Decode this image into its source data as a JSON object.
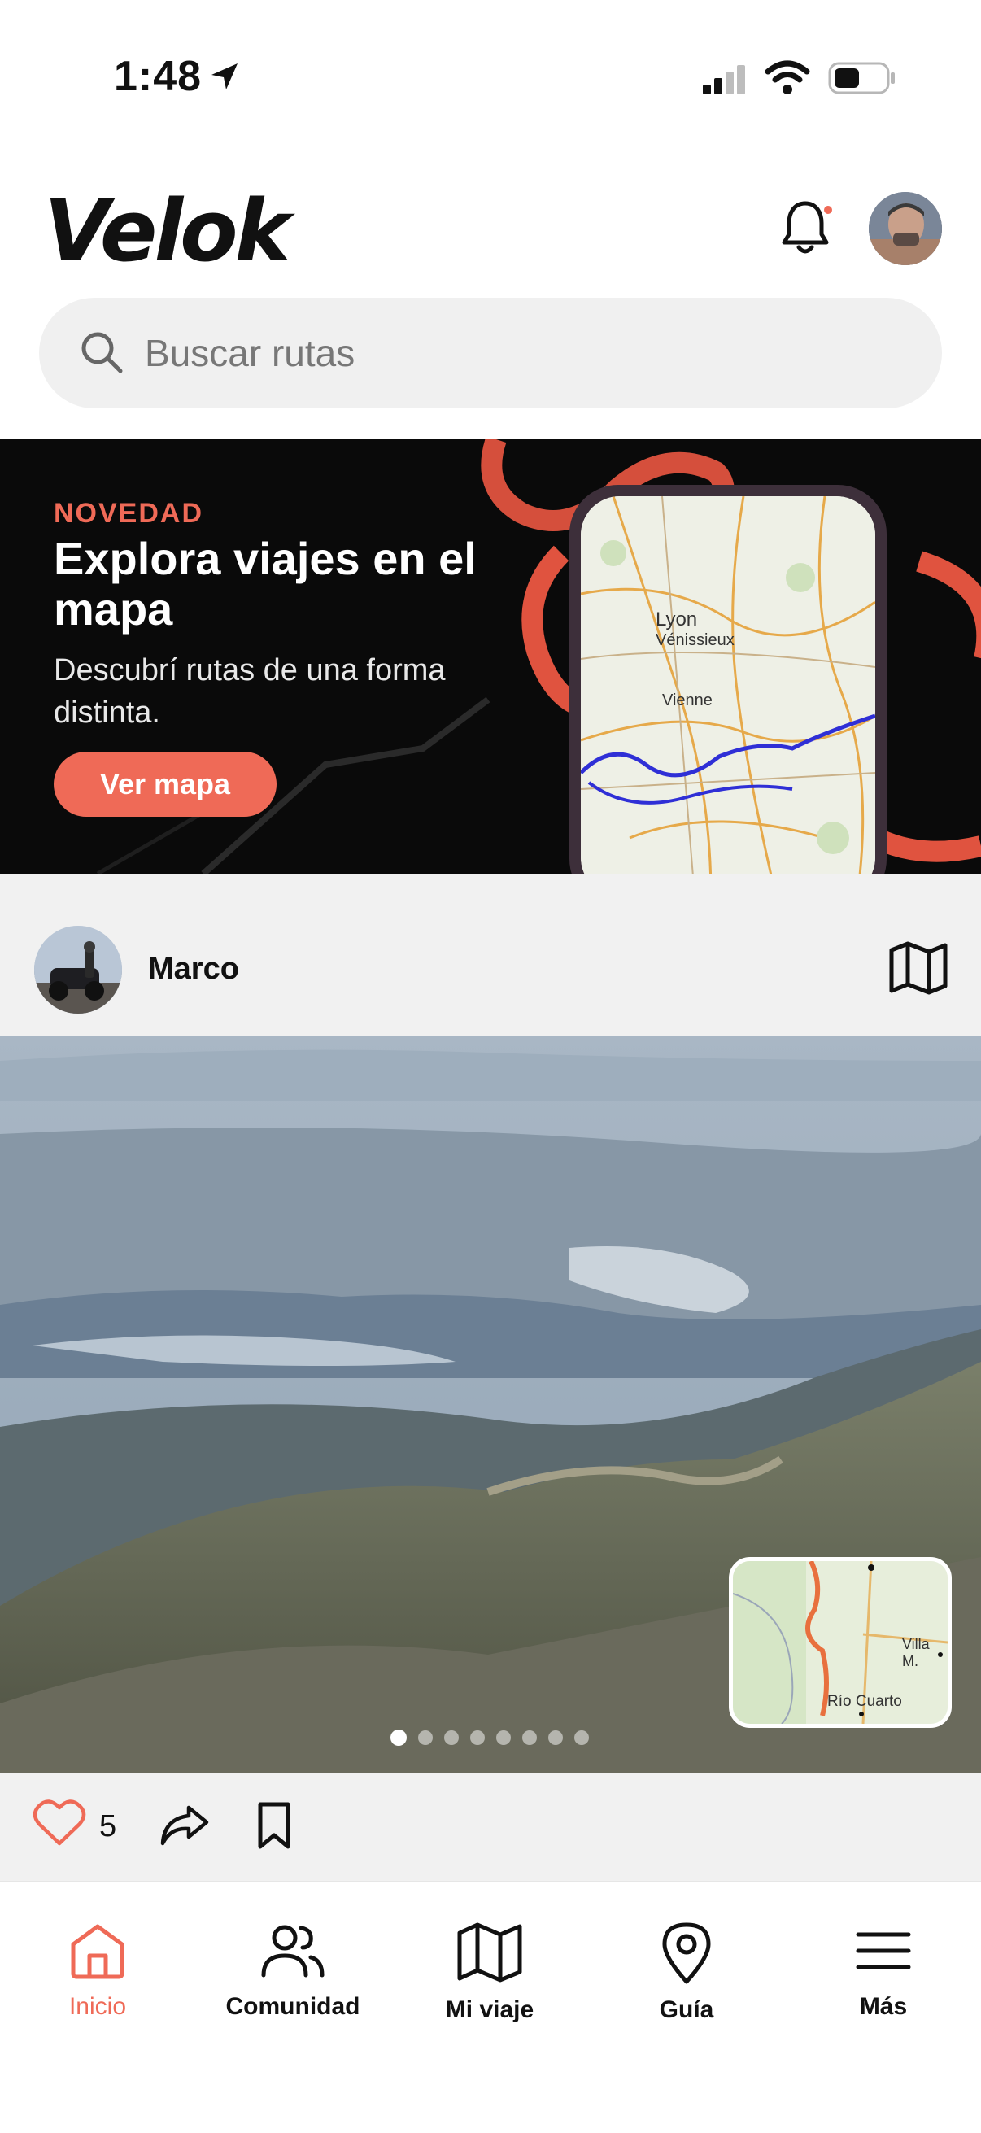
{
  "status": {
    "time": "1:48"
  },
  "app": {
    "name": "Velok"
  },
  "search": {
    "placeholder": "Buscar rutas"
  },
  "banner": {
    "eyebrow": "NOVEDAD",
    "title": "Explora viajes en el mapa",
    "subtitle": "Descubrí rutas de una forma distinta.",
    "button": "Ver mapa",
    "map_labels": [
      "Lyon",
      "Vénissieux",
      "Vienne"
    ]
  },
  "post": {
    "user": "Marco",
    "likes": "5",
    "photo_count": 8,
    "active_photo": 1,
    "minimap_labels": [
      "Villa M.",
      "Río Cuarto"
    ]
  },
  "nav": {
    "items": [
      {
        "label": "Inicio",
        "icon": "home-icon"
      },
      {
        "label": "Comunidad",
        "icon": "users-icon"
      },
      {
        "label": "Mi viaje",
        "icon": "map-icon"
      },
      {
        "label": "Guía",
        "icon": "pin-icon"
      },
      {
        "label": "Más",
        "icon": "menu-icon"
      }
    ],
    "active": "Inicio"
  },
  "colors": {
    "accent": "#ef6a57",
    "background": "#ffffff",
    "card": "#f1f1f1",
    "banner": "#0a0a0a"
  }
}
